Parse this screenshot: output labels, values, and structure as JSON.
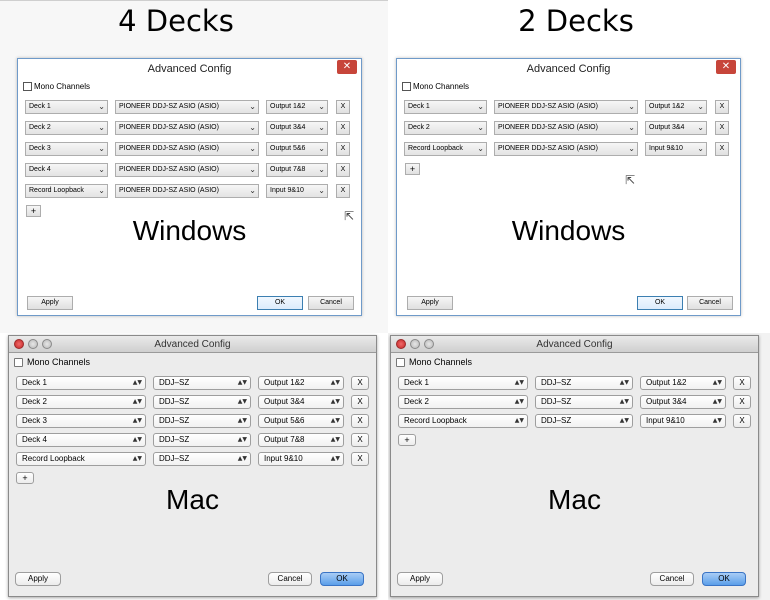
{
  "panels": {
    "win4": {
      "heading": "4 Decks",
      "dialog_title": "Advanced Config",
      "close_glyph": "✕",
      "mono_label": "Mono Channels",
      "rows": [
        {
          "deck": "Deck 1",
          "device": "PIONEER DDJ-SZ ASIO (ASIO)",
          "io": "Output 1&2"
        },
        {
          "deck": "Deck 2",
          "device": "PIONEER DDJ-SZ ASIO (ASIO)",
          "io": "Output 3&4"
        },
        {
          "deck": "Deck 3",
          "device": "PIONEER DDJ-SZ ASIO (ASIO)",
          "io": "Output 5&6"
        },
        {
          "deck": "Deck 4",
          "device": "PIONEER DDJ-SZ ASIO (ASIO)",
          "io": "Output 7&8"
        },
        {
          "deck": "Record Loopback",
          "device": "PIONEER DDJ-SZ ASIO (ASIO)",
          "io": "Input 9&10"
        }
      ],
      "remove_label": "X",
      "add_label": "+",
      "platform_label": "Windows",
      "apply_label": "Apply",
      "ok_label": "OK",
      "cancel_label": "Cancel"
    },
    "win2": {
      "heading": "2 Decks",
      "dialog_title": "Advanced Config",
      "close_glyph": "✕",
      "mono_label": "Mono Channels",
      "rows": [
        {
          "deck": "Deck 1",
          "device": "PIONEER DDJ-SZ ASIO (ASIO)",
          "io": "Output 1&2"
        },
        {
          "deck": "Deck 2",
          "device": "PIONEER DDJ-SZ ASIO (ASIO)",
          "io": "Output 3&4"
        },
        {
          "deck": "Record Loopback",
          "device": "PIONEER DDJ-SZ ASIO (ASIO)",
          "io": "Input 9&10"
        }
      ],
      "remove_label": "X",
      "add_label": "+",
      "platform_label": "Windows",
      "apply_label": "Apply",
      "ok_label": "OK",
      "cancel_label": "Cancel"
    },
    "mac4": {
      "dialog_title": "Advanced Config",
      "mono_label": "Mono Channels",
      "rows": [
        {
          "deck": "Deck 1",
          "device": "DDJ–SZ",
          "io": "Output 1&2"
        },
        {
          "deck": "Deck 2",
          "device": "DDJ–SZ",
          "io": "Output 3&4"
        },
        {
          "deck": "Deck 3",
          "device": "DDJ–SZ",
          "io": "Output 5&6"
        },
        {
          "deck": "Deck 4",
          "device": "DDJ–SZ",
          "io": "Output 7&8"
        },
        {
          "deck": "Record Loopback",
          "device": "DDJ–SZ",
          "io": "Input 9&10"
        }
      ],
      "remove_label": "X",
      "add_label": "+",
      "platform_label": "Mac",
      "apply_label": "Apply",
      "ok_label": "OK",
      "cancel_label": "Cancel"
    },
    "mac2": {
      "dialog_title": "Advanced Config",
      "mono_label": "Mono Channels",
      "rows": [
        {
          "deck": "Deck 1",
          "device": "DDJ–SZ",
          "io": "Output 1&2"
        },
        {
          "deck": "Deck 2",
          "device": "DDJ–SZ",
          "io": "Output 3&4"
        },
        {
          "deck": "Record Loopback",
          "device": "DDJ–SZ",
          "io": "Input 9&10"
        }
      ],
      "remove_label": "X",
      "add_label": "+",
      "platform_label": "Mac",
      "apply_label": "Apply",
      "ok_label": "OK",
      "cancel_label": "Cancel"
    }
  },
  "icons": {
    "dropdown_arrow": "⌄",
    "stepper_arrows": "▲▼",
    "cursor": "⇱"
  },
  "colors": {
    "win_close": "#c7453a",
    "win_default_button": "#3c7fb1",
    "mac_default_button": "#5a9ee9",
    "mac_close_light": "#c62828"
  }
}
